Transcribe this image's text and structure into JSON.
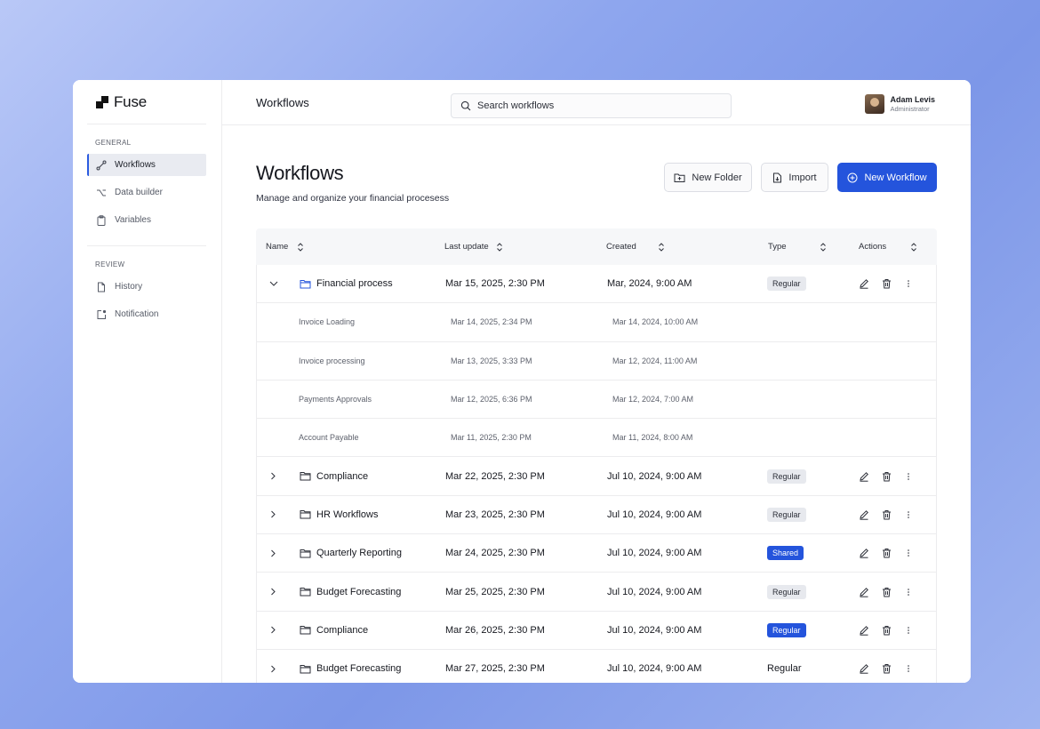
{
  "app": {
    "name": "Fuse"
  },
  "sidebar": {
    "sections": [
      {
        "title": "GENERAL",
        "items": [
          {
            "label": "Workflows",
            "icon": "workflow-icon",
            "active": true
          },
          {
            "label": "Data builder",
            "icon": "option-key-icon",
            "active": false
          },
          {
            "label": "Variables",
            "icon": "clipboard-icon",
            "active": false
          }
        ]
      },
      {
        "title": "REVIEW",
        "items": [
          {
            "label": "History",
            "icon": "file-icon",
            "active": false
          },
          {
            "label": "Notification",
            "icon": "notification-icon",
            "active": false
          }
        ]
      }
    ]
  },
  "topbar": {
    "title": "Workflows",
    "search_placeholder": "Search workflows",
    "user": {
      "name": "Adam Levis",
      "role": "Administrator"
    }
  },
  "page": {
    "title": "Workflows",
    "subtitle": "Manage and organize your financial procesess",
    "buttons": {
      "new_folder": "New Folder",
      "import": "Import",
      "new_workflow": "New Workflow"
    }
  },
  "table": {
    "headers": {
      "name": "Name",
      "last_update": "Last update",
      "created": "Created",
      "type": "Type",
      "actions": "Actions"
    },
    "rows": [
      {
        "kind": "folder",
        "expanded": true,
        "name": "Financial process",
        "last_update": "Mar 15, 2025, 2:30 PM",
        "created": "Mar, 2024, 9:00 AM",
        "type": "Regular",
        "type_style": "gray"
      },
      {
        "kind": "sub",
        "name": "Invoice Loading",
        "last_update": "Mar 14, 2025, 2:34 PM",
        "created": "Mar 14, 2024, 10:00 AM"
      },
      {
        "kind": "sub",
        "name": "Invoice processing",
        "last_update": "Mar 13, 2025, 3:33 PM",
        "created": "Mar 12, 2024, 11:00 AM"
      },
      {
        "kind": "sub",
        "name": "Payments Approvals",
        "last_update": "Mar 12, 2025, 6:36 PM",
        "created": "Mar 12, 2024, 7:00 AM"
      },
      {
        "kind": "sub",
        "name": "Account Payable",
        "last_update": "Mar 11, 2025, 2:30 PM",
        "created": "Mar 11, 2024, 8:00 AM"
      },
      {
        "kind": "folder",
        "expanded": false,
        "name": "Compliance",
        "last_update": "Mar 22, 2025, 2:30 PM",
        "created": "Jul 10, 2024, 9:00 AM",
        "type": "Regular",
        "type_style": "gray"
      },
      {
        "kind": "folder",
        "expanded": false,
        "name": "HR Workflows",
        "last_update": "Mar 23, 2025, 2:30 PM",
        "created": "Jul 10, 2024, 9:00 AM",
        "type": "Regular",
        "type_style": "gray"
      },
      {
        "kind": "folder",
        "expanded": false,
        "name": "Quarterly Reporting",
        "last_update": "Mar 24, 2025, 2:30 PM",
        "created": "Jul 10, 2024, 9:00 AM",
        "type": "Shared",
        "type_style": "blue"
      },
      {
        "kind": "folder",
        "expanded": false,
        "name": "Budget Forecasting",
        "last_update": "Mar 25, 2025, 2:30 PM",
        "created": "Jul 10, 2024, 9:00 AM",
        "type": "Regular",
        "type_style": "gray"
      },
      {
        "kind": "folder",
        "expanded": false,
        "name": "Compliance",
        "last_update": "Mar 26, 2025, 2:30 PM",
        "created": "Jul 10, 2024, 9:00 AM",
        "type": "Regular",
        "type_style": "blue"
      },
      {
        "kind": "folder",
        "expanded": false,
        "name": "Budget Forecasting",
        "last_update": "Mar 27, 2025, 2:30 PM",
        "created": "Jul 10, 2024, 9:00 AM",
        "type": "Regular",
        "type_style": "plain"
      }
    ]
  },
  "colors": {
    "accent": "#2454dc",
    "badge_gray": "#e7e9ee",
    "border": "#ececee"
  }
}
